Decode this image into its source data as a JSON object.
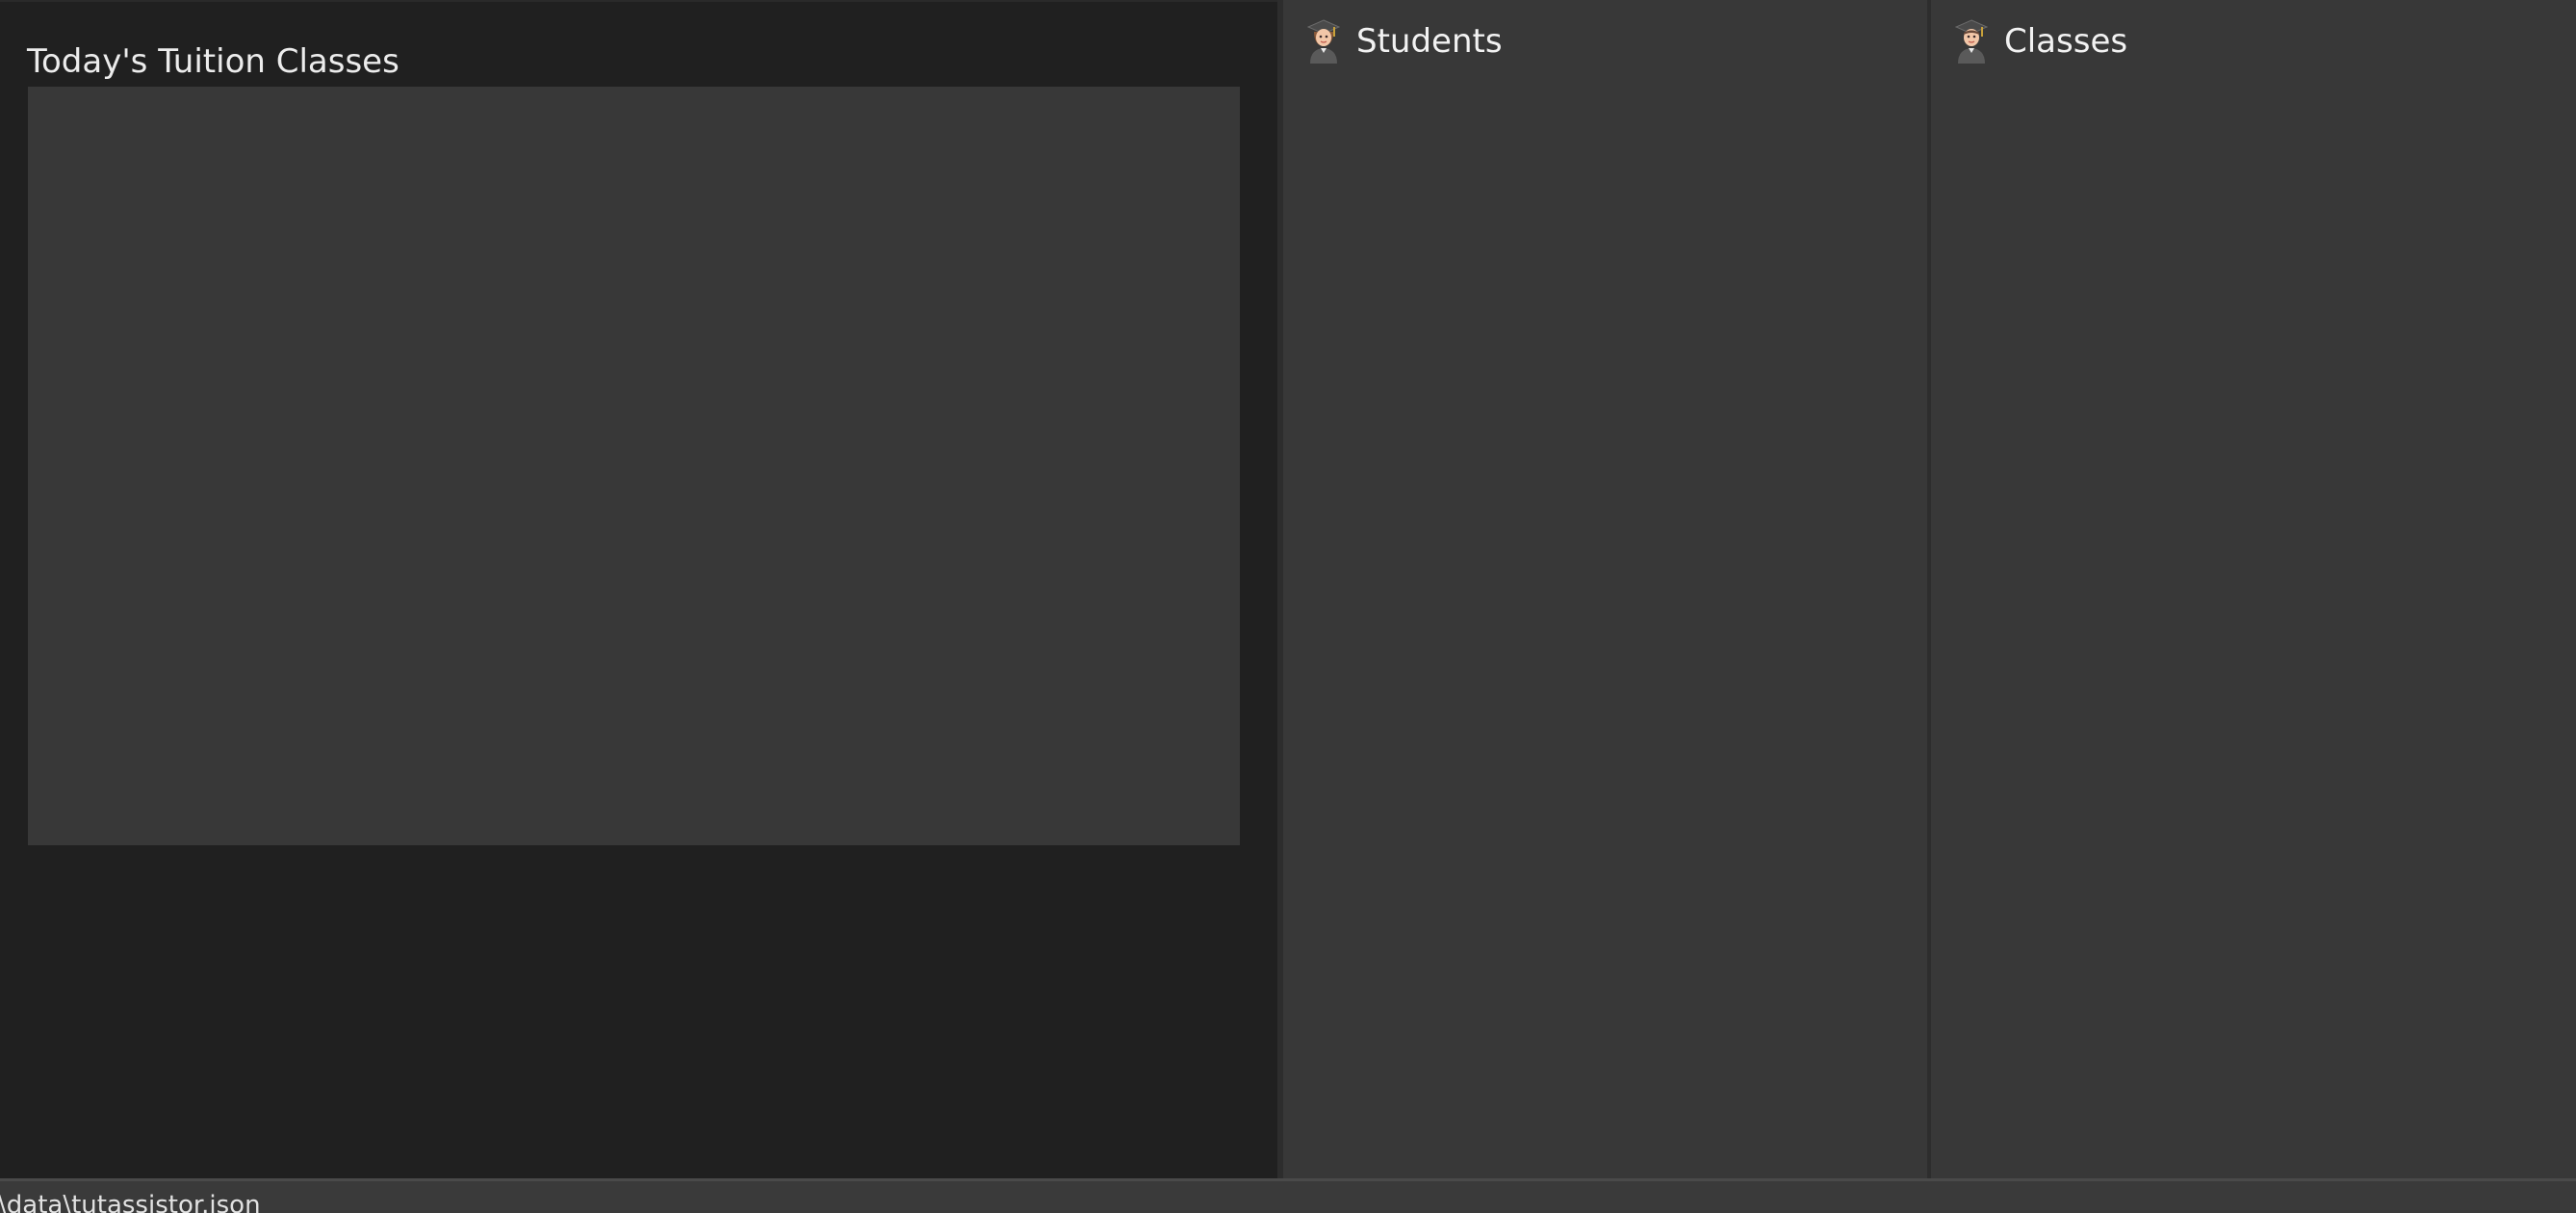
{
  "today_panel": {
    "title": "Today's Tuition Classes"
  },
  "students_panel": {
    "title": "Students",
    "icon": "graduate-student-icon"
  },
  "classes_panel": {
    "title": "Classes",
    "icon": "graduate-student-icon"
  },
  "status_bar": {
    "save_location": "\\data\\tutassistor.json"
  },
  "colors": {
    "background_dark": "#202020",
    "panel": "#383838",
    "text": "#ececec"
  }
}
